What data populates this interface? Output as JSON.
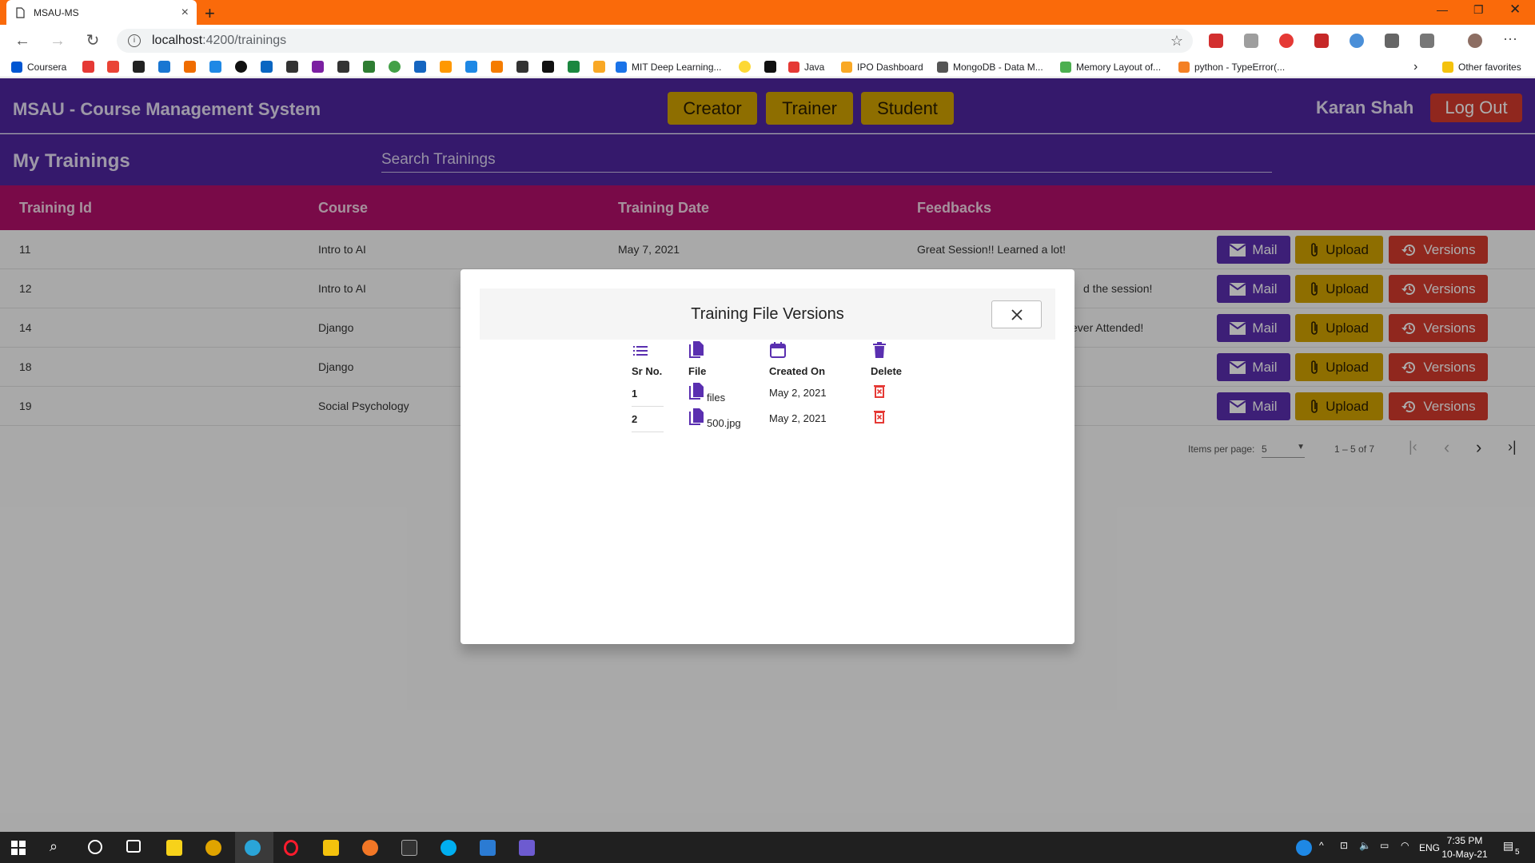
{
  "browser": {
    "tab_title": "MSAU-MS",
    "url_host": "localhost",
    "url_path": ":4200/trainings",
    "bookmarks": [
      {
        "label": "Coursera",
        "color": "#0056d2"
      },
      {
        "label": "MIT Deep Learning...",
        "color": "#1a73e8"
      },
      {
        "label": "Java",
        "color": "#e53935"
      },
      {
        "label": "IPO Dashboard",
        "color": "#f9a825"
      },
      {
        "label": "MongoDB - Data M...",
        "color": "#555555"
      },
      {
        "label": "Memory Layout of...",
        "color": "#4caf50"
      },
      {
        "label": "python - TypeError(...",
        "color": "#f48024"
      }
    ],
    "other_favorites": "Other favorites"
  },
  "app": {
    "title": "MSAU - Course Management System",
    "roles": [
      "Creator",
      "Trainer",
      "Student"
    ],
    "user_name": "Karan Shah",
    "logout_label": "Log Out",
    "page_title": "My Trainings",
    "search_placeholder": "Search Trainings",
    "colors": {
      "primary": "#4e26a0",
      "accent": "#b30f6a",
      "yellow": "#d1a300",
      "red": "#d53a2d"
    }
  },
  "table": {
    "headers": [
      "Training Id",
      "Course",
      "Training Date",
      "Feedbacks"
    ],
    "actions": {
      "mail": "Mail",
      "upload": "Upload",
      "versions": "Versions"
    },
    "rows": [
      {
        "id": "11",
        "course": "Intro to AI",
        "date": "May 7, 2021",
        "feedback": "Great Session!! Learned a lot!"
      },
      {
        "id": "12",
        "course": "Intro to AI",
        "date": "",
        "feedback": "d the session!"
      },
      {
        "id": "14",
        "course": "Django",
        "date": "",
        "feedback": "ever Attended!"
      },
      {
        "id": "18",
        "course": "Django",
        "date": "",
        "feedback": ""
      },
      {
        "id": "19",
        "course": "Social Psychology",
        "date": "",
        "feedback": ""
      }
    ]
  },
  "paginator": {
    "items_per_page_label": "Items per page:",
    "items_per_page_value": "5",
    "range_label": "1 – 5 of 7"
  },
  "dialog": {
    "title": "Training File Versions",
    "headers": [
      "Sr No.",
      "File",
      "Created On",
      "Delete"
    ],
    "rows": [
      {
        "sr": "1",
        "file": "files",
        "created": "May 2, 2021"
      },
      {
        "sr": "2",
        "file": "500.jpg",
        "created": "May 2, 2021"
      }
    ]
  },
  "taskbar": {
    "lang": "ENG",
    "time": "7:35 PM",
    "date": "10-May-21",
    "notifications": "5"
  }
}
